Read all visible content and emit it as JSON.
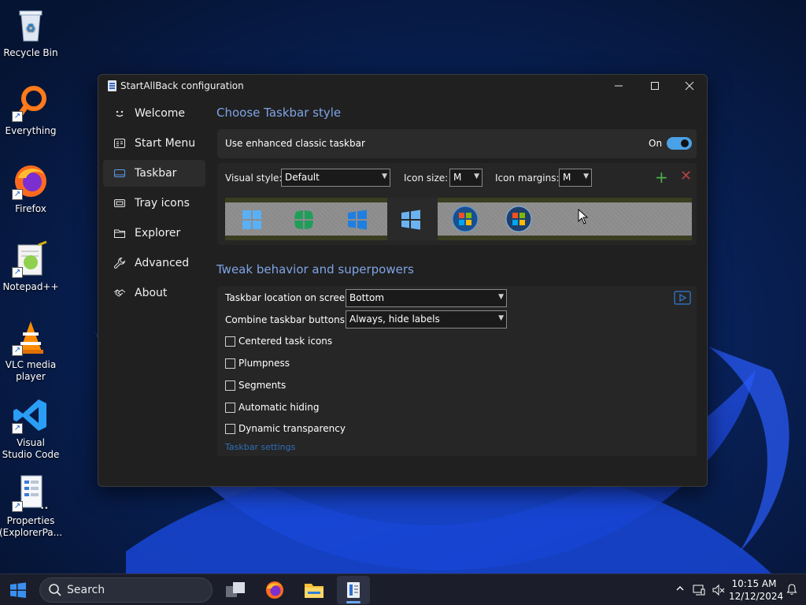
{
  "desktop": {
    "icons": [
      {
        "label": "Recycle Bin"
      },
      {
        "label": "Everything"
      },
      {
        "label": "Firefox"
      },
      {
        "label": "Notepad++"
      },
      {
        "label": "VLC media player"
      },
      {
        "label": "Visual Studio Code"
      },
      {
        "label": "Properties (ExplorerPa..."
      }
    ]
  },
  "window": {
    "title": "StartAllBack configuration",
    "controls": {
      "minimize": "—",
      "maximize": "☐",
      "close": "✕"
    }
  },
  "sidebar": {
    "items": [
      {
        "label": "Welcome",
        "icon": "smile-icon"
      },
      {
        "label": "Start Menu",
        "icon": "start-menu-icon"
      },
      {
        "label": "Taskbar",
        "icon": "taskbar-icon",
        "active": true
      },
      {
        "label": "Tray icons",
        "icon": "tray-icon"
      },
      {
        "label": "Explorer",
        "icon": "folder-icon"
      },
      {
        "label": "Advanced",
        "icon": "wrench-icon"
      },
      {
        "label": "About",
        "icon": "handshake-icon"
      }
    ]
  },
  "taskbar_style": {
    "heading": "Choose Taskbar style",
    "enhanced_label": "Use enhanced classic taskbar",
    "enhanced_state": "On",
    "visual_style_label": "Visual style:",
    "visual_style_value": "Default",
    "icon_size_label": "Icon size:",
    "icon_size_value": "M",
    "icon_margins_label": "Icon margins:",
    "icon_margins_value": "M",
    "add_symbol": "+",
    "remove_symbol": "✕"
  },
  "tweaks": {
    "heading": "Tweak behavior and superpowers",
    "location_label": "Taskbar location on screen:",
    "location_value": "Bottom",
    "combine_label": "Combine taskbar buttons:",
    "combine_value": "Always, hide labels",
    "checkboxes": [
      {
        "label": "Centered task icons",
        "checked": false
      },
      {
        "label": "Plumpness",
        "checked": false
      },
      {
        "label": "Segments",
        "checked": false
      },
      {
        "label": "Automatic hiding",
        "checked": false
      },
      {
        "label": "Dynamic transparency",
        "checked": false
      }
    ],
    "settings_link": "Taskbar settings"
  },
  "taskbar": {
    "search_placeholder": "Search",
    "time": "10:15 AM",
    "date": "12/12/2024"
  },
  "colors": {
    "accent": "#4aa1e6",
    "heading": "#7fa4e6",
    "link": "#2e6fb8",
    "window_bg": "#202020"
  }
}
